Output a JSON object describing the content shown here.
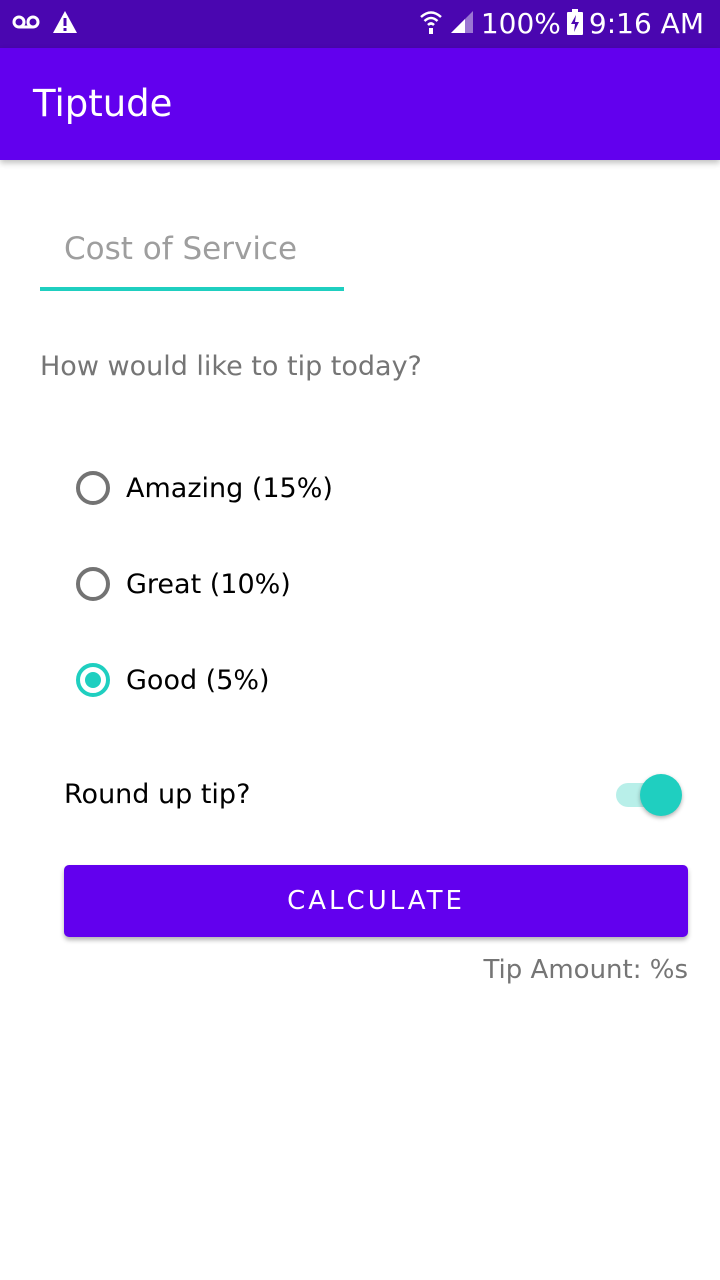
{
  "status_bar": {
    "battery": "100%",
    "time": "9:16 AM",
    "icons": [
      "voicemail-icon",
      "warning-icon",
      "wifi-icon",
      "cell-signal-icon",
      "battery-charging-icon"
    ]
  },
  "app_bar": {
    "title": "Tiptude"
  },
  "cost_field": {
    "placeholder": "Cost of Service",
    "value": ""
  },
  "question": "How would like to tip today?",
  "tip_options": [
    {
      "label": "Amazing (15%)",
      "selected": false
    },
    {
      "label": "Great (10%)",
      "selected": false
    },
    {
      "label": "Good (5%)",
      "selected": true
    }
  ],
  "round_up": {
    "label": "Round up tip?",
    "enabled": true
  },
  "calculate_label": "CALCULATE",
  "tip_amount": "Tip Amount: %s",
  "colors": {
    "status_bar": "#4a06b0",
    "primary": "#6200ee",
    "accent": "#1fcfc0"
  }
}
